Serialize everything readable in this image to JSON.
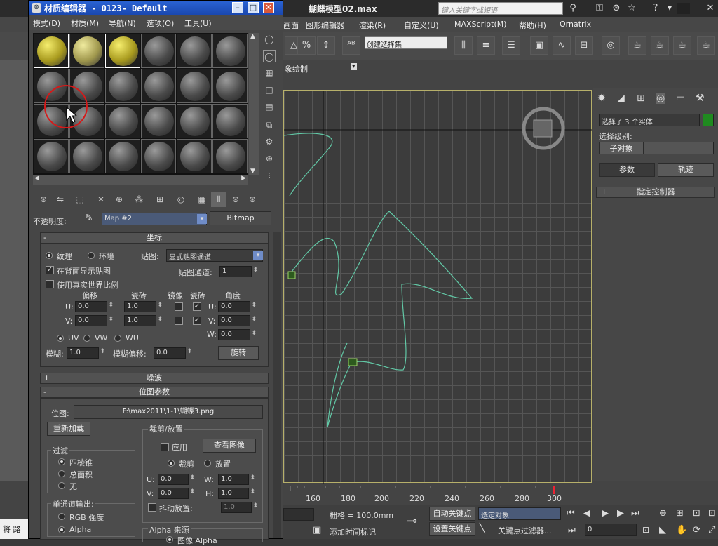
{
  "main": {
    "title": "蝴蝶模型02.max",
    "search_placeholder": "键入关键字或短语",
    "menu": [
      "画面",
      "图形编辑器",
      "渲染(R)",
      "自定义(U)",
      "MAXScript(M)",
      "帮助(H)",
      "Ornatrix"
    ],
    "selection_set": "创建选择集",
    "viewport_label": "象绘制",
    "right_panel": {
      "selected_text": "选择了 3 个实体",
      "select_level_label": "选择级别:",
      "sub_object": "子对象",
      "tab_params": "参数",
      "tab_track": "轨迹",
      "assign_controller": "指定控制器",
      "accent_color": "#1f8a1f"
    },
    "timeline_ticks": [
      "160",
      "180",
      "200",
      "220",
      "240",
      "260",
      "280",
      "300"
    ],
    "bottom": {
      "grid": "栅格 = 100.0mm",
      "add_time_tag": "添加时间标记",
      "auto_key": "自动关键点",
      "set_key": "设置关键点",
      "selected_object": "选定对象",
      "key_filter": "关键点过滤器...",
      "frame": "0"
    },
    "status_left": "将 路"
  },
  "med": {
    "title": "材质编辑器 - 0123- Default",
    "menu": [
      "模式(D)",
      "材质(M)",
      "导航(N)",
      "选项(O)",
      "工具(U)"
    ],
    "opacity_label": "不透明度:",
    "map_name": "Map #2",
    "map_type": "Bitmap",
    "coords": {
      "header": "坐标",
      "texture": "纹理",
      "environment": "环境",
      "mapping_label": "贴图:",
      "mapping_value": "显式贴图通道",
      "show_on_back": "在背面显示贴图",
      "map_channel_label": "贴图通道:",
      "map_channel": "1",
      "real_world": "使用真实世界比例",
      "offset": "偏移",
      "tiling": "瓷砖",
      "mirror": "镜像",
      "tile": "瓷砖",
      "angle": "角度",
      "u_offset": "0.0",
      "v_offset": "0.0",
      "u_tiling": "1.0",
      "v_tiling": "1.0",
      "u_angle": "0.0",
      "v_angle": "0.0",
      "w_angle": "0.0",
      "uv": "UV",
      "vw": "VW",
      "wu": "WU",
      "blur_label": "模糊:",
      "blur": "1.0",
      "blur_offset_label": "模糊偏移:",
      "blur_offset": "0.0",
      "rotate": "旋转"
    },
    "noise_header": "噪波",
    "bitmap": {
      "header": "位图参数",
      "bitmap_label": "位图:",
      "path": "F:\\max2011\\1-1\\蝴蝶3.png",
      "reload": "重新加载",
      "crop_group": "裁剪/放置",
      "apply": "应用",
      "view_image": "查看图像",
      "crop": "裁剪",
      "place": "放置",
      "u": "0.0",
      "v": "0.0",
      "w": "1.0",
      "h": "1.0",
      "jitter_label": "抖动放置:",
      "jitter": "1.0",
      "filter_group": "过滤",
      "pyramidal": "四棱锥",
      "summed": "总面积",
      "none": "无",
      "mono_group": "单通道输出:",
      "rgb": "RGB 强度",
      "alpha": "Alpha",
      "alpha_source": "Alpha 来源",
      "image_alpha": "图像 Alpha"
    }
  }
}
